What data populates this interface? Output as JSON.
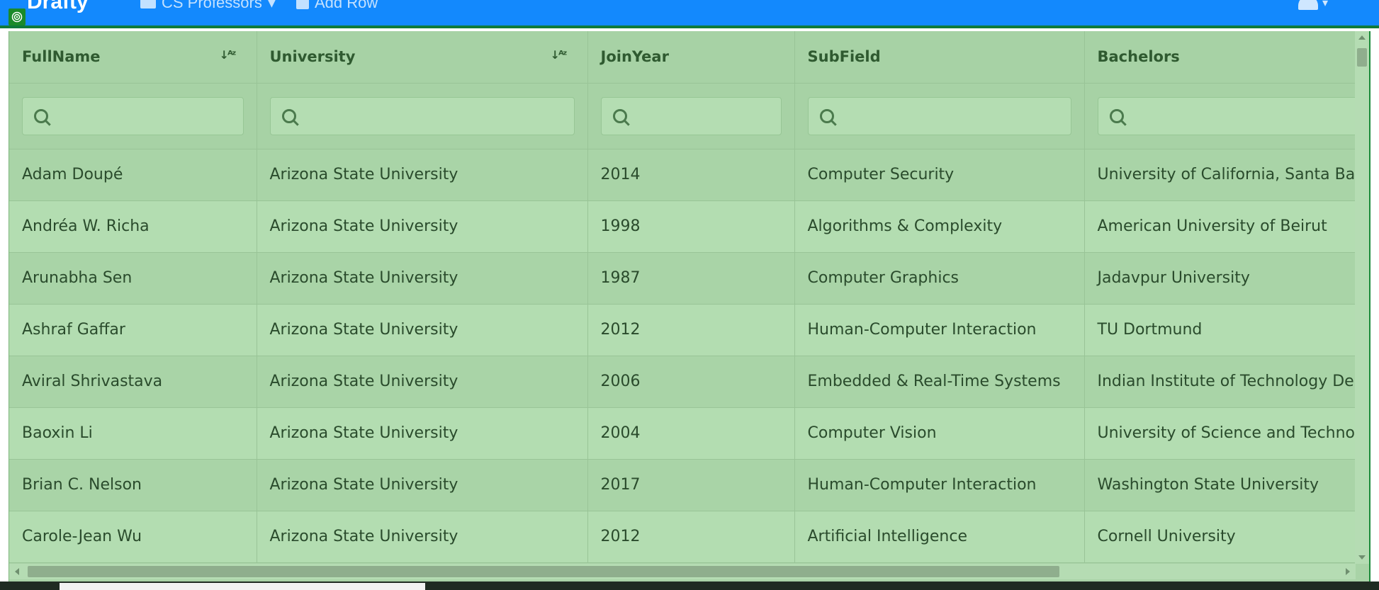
{
  "app": {
    "brand": "Drafty",
    "nav": {
      "sheet_label": "CS Professors",
      "add_row_label": "Add Row"
    }
  },
  "table": {
    "columns": [
      {
        "label": "FullName",
        "sortable": true
      },
      {
        "label": "University",
        "sortable": true
      },
      {
        "label": "JoinYear",
        "sortable": false
      },
      {
        "label": "SubField",
        "sortable": false
      },
      {
        "label": "Bachelors",
        "sortable": false
      }
    ],
    "filters": [
      {
        "placeholder": ""
      },
      {
        "placeholder": ""
      },
      {
        "placeholder": ""
      },
      {
        "placeholder": ""
      },
      {
        "placeholder": ""
      }
    ],
    "rows": [
      [
        "Adam Doupé",
        "Arizona State University",
        "2014",
        "Computer Security",
        "University of California, Santa Barbara"
      ],
      [
        "Andréa W. Richa",
        "Arizona State University",
        "1998",
        "Algorithms & Complexity",
        "American University of Beirut"
      ],
      [
        "Arunabha Sen",
        "Arizona State University",
        "1987",
        "Computer Graphics",
        "Jadavpur University"
      ],
      [
        "Ashraf Gaffar",
        "Arizona State University",
        "2012",
        "Human-Computer Interaction",
        "TU Dortmund"
      ],
      [
        "Aviral Shrivastava",
        "Arizona State University",
        "2006",
        "Embedded & Real-Time Systems",
        "Indian Institute of Technology Delhi"
      ],
      [
        "Baoxin Li",
        "Arizona State University",
        "2004",
        "Computer Vision",
        "University of Science and Technology of China"
      ],
      [
        "Brian C. Nelson",
        "Arizona State University",
        "2017",
        "Human-Computer Interaction",
        "Washington State University"
      ],
      [
        "Carole-Jean Wu",
        "Arizona State University",
        "2012",
        "Artificial Intelligence",
        "Cornell University"
      ]
    ]
  },
  "colors": {
    "topbar": "#1389fd",
    "grid_odd": "#a9d4a7",
    "grid_even": "#b3ddb1",
    "text": "#2a4b2c"
  },
  "icons": {
    "sort": "sort-alpha-icon",
    "filter": "search-icon"
  }
}
